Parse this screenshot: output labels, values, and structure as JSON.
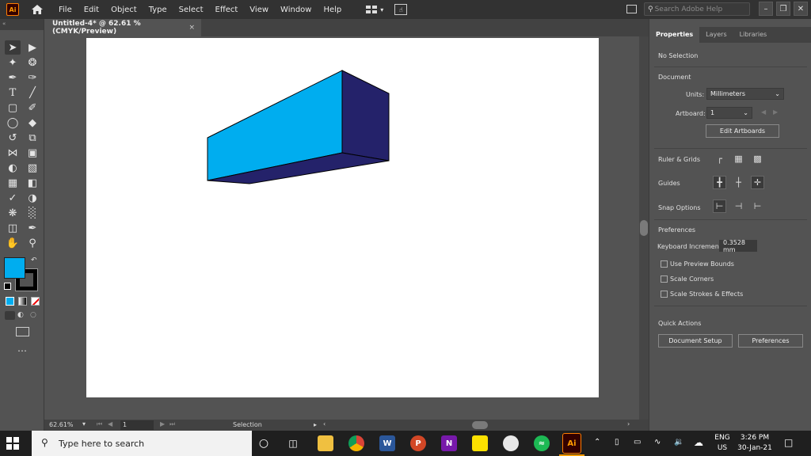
{
  "app": {
    "logo": "Ai"
  },
  "menu": [
    "File",
    "Edit",
    "Object",
    "Type",
    "Select",
    "Effect",
    "View",
    "Window",
    "Help"
  ],
  "search": {
    "placeholder": "Search Adobe Help"
  },
  "document": {
    "tab_title": "Untitled-4* @ 62.61 % (CMYK/Preview)",
    "close": "×"
  },
  "status": {
    "zoom": "62.61%",
    "page": "1",
    "mode": "Selection"
  },
  "panel": {
    "tabs": [
      "Properties",
      "Layers",
      "Libraries"
    ],
    "selection": "No Selection",
    "document_header": "Document",
    "units_label": "Units:",
    "units_value": "Millimeters",
    "artboard_label": "Artboard:",
    "artboard_value": "1",
    "edit_artboards": "Edit Artboards",
    "ruler_grids": "Ruler & Grids",
    "guides": "Guides",
    "snap_options": "Snap Options",
    "preferences_header": "Preferences",
    "keyboard_increment_label": "Keyboard Increment:",
    "keyboard_increment_value": "0.3528 mm",
    "checkboxes": [
      "Use Preview Bounds",
      "Scale Corners",
      "Scale Strokes & Effects"
    ],
    "quick_actions": "Quick Actions",
    "document_setup": "Document Setup",
    "preferences_btn": "Preferences"
  },
  "taskbar": {
    "search_placeholder": "Type here to search",
    "lang": "ENG",
    "region": "US",
    "time": "3:26 PM",
    "date": "30-Jan-21"
  },
  "colors": {
    "fill": "#00adef",
    "stroke": "#000000",
    "box_front": "#00adef",
    "box_side": "#24226a"
  }
}
